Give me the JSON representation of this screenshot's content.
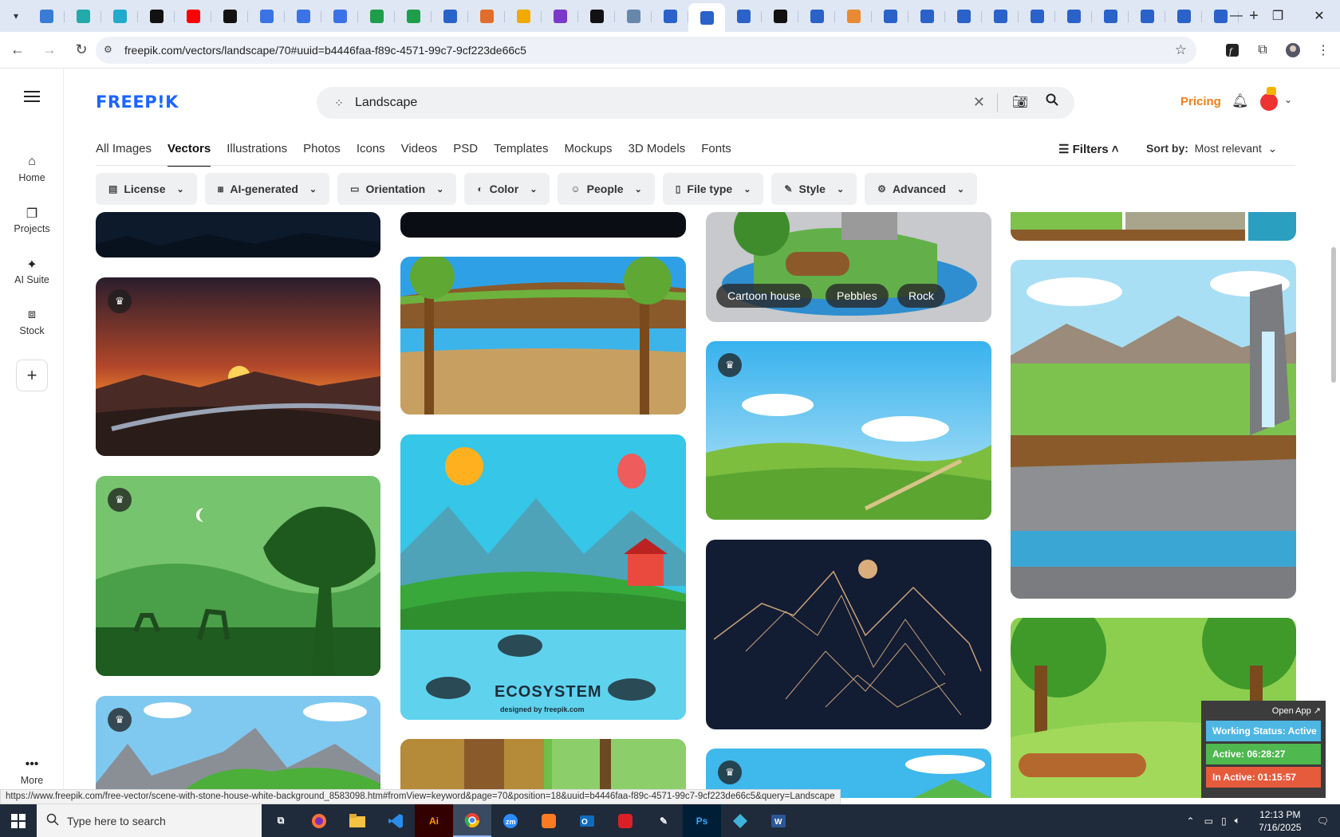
{
  "browser": {
    "url": "freepik.com/vectors/landscape/70#uuid=b4446faa-f89c-4571-99c7-9cf223de66c5",
    "tab_favicons": [
      "#3a7bd5",
      "#2aa",
      "#22aacc",
      "#111",
      "#f00",
      "#111",
      "#3b73e6",
      "#3b73e6",
      "#3b73e6",
      "#1e9e4a",
      "#1e9e4a",
      "#2a62c9",
      "#e06d2b",
      "#f2a900",
      "#7a39c9",
      "#111",
      "#6688aa",
      "#2a62c9",
      "#2a62c9",
      "#2a62c9",
      "#111",
      "#2a62c9",
      "#e88a33",
      "#2a62c9",
      "#2a62c9",
      "#2a62c9",
      "#2a62c9",
      "#2a62c9",
      "#2a62c9",
      "#2a62c9",
      "#2a62c9",
      "#2a62c9",
      "#2a62c9"
    ],
    "active_tab_index": 18,
    "status_url": "https://www.freepik.com/free-vector/scene-with-stone-house-white-background_8583098.htm#fromView=keyword&page=70&position=18&uuid=b4446faa-f89c-4571-99c7-9cf223de66c5&query=Landscape"
  },
  "rail": {
    "items": [
      {
        "icon": "home-icon",
        "label": "Home"
      },
      {
        "icon": "projects-icon",
        "label": "Projects"
      },
      {
        "icon": "ai-suite-icon",
        "label": "AI Suite"
      },
      {
        "icon": "stock-icon",
        "label": "Stock"
      }
    ],
    "more_label": "More"
  },
  "header": {
    "logo": "FREEP!K",
    "search_value": "Landscape",
    "pricing": "Pricing"
  },
  "cattabs": [
    "All Images",
    "Vectors",
    "Illustrations",
    "Photos",
    "Icons",
    "Videos",
    "PSD",
    "Templates",
    "Mockups",
    "3D Models",
    "Fonts"
  ],
  "active_cattab": "Vectors",
  "filters_label": "Filters",
  "sort": {
    "label": "Sort by:",
    "value": "Most relevant"
  },
  "chips": [
    {
      "icon": "license-icon",
      "label": "License"
    },
    {
      "icon": "ai-generated-icon",
      "label": "AI-generated"
    },
    {
      "icon": "orientation-icon",
      "label": "Orientation"
    },
    {
      "icon": "color-icon",
      "label": "Color"
    },
    {
      "icon": "people-icon",
      "label": "People"
    },
    {
      "icon": "file-type-icon",
      "label": "File type"
    },
    {
      "icon": "style-icon",
      "label": "Style"
    },
    {
      "icon": "advanced-icon",
      "label": "Advanced"
    }
  ],
  "tags": [
    "Cartoon house",
    "Pebbles",
    "Rock"
  ],
  "ecosystem_text": "ECOSYSTEM",
  "ecosystem_credit": "designed by freepik.com",
  "widget": {
    "open_app": "Open App ↗",
    "status": "Working Status: Active",
    "active": "Active: 06:28:27",
    "inactive": "In Active: 01:15:57"
  },
  "taskbar": {
    "search_placeholder": "Type here to search",
    "time": "12:13 PM",
    "date": "7/16/2025"
  }
}
